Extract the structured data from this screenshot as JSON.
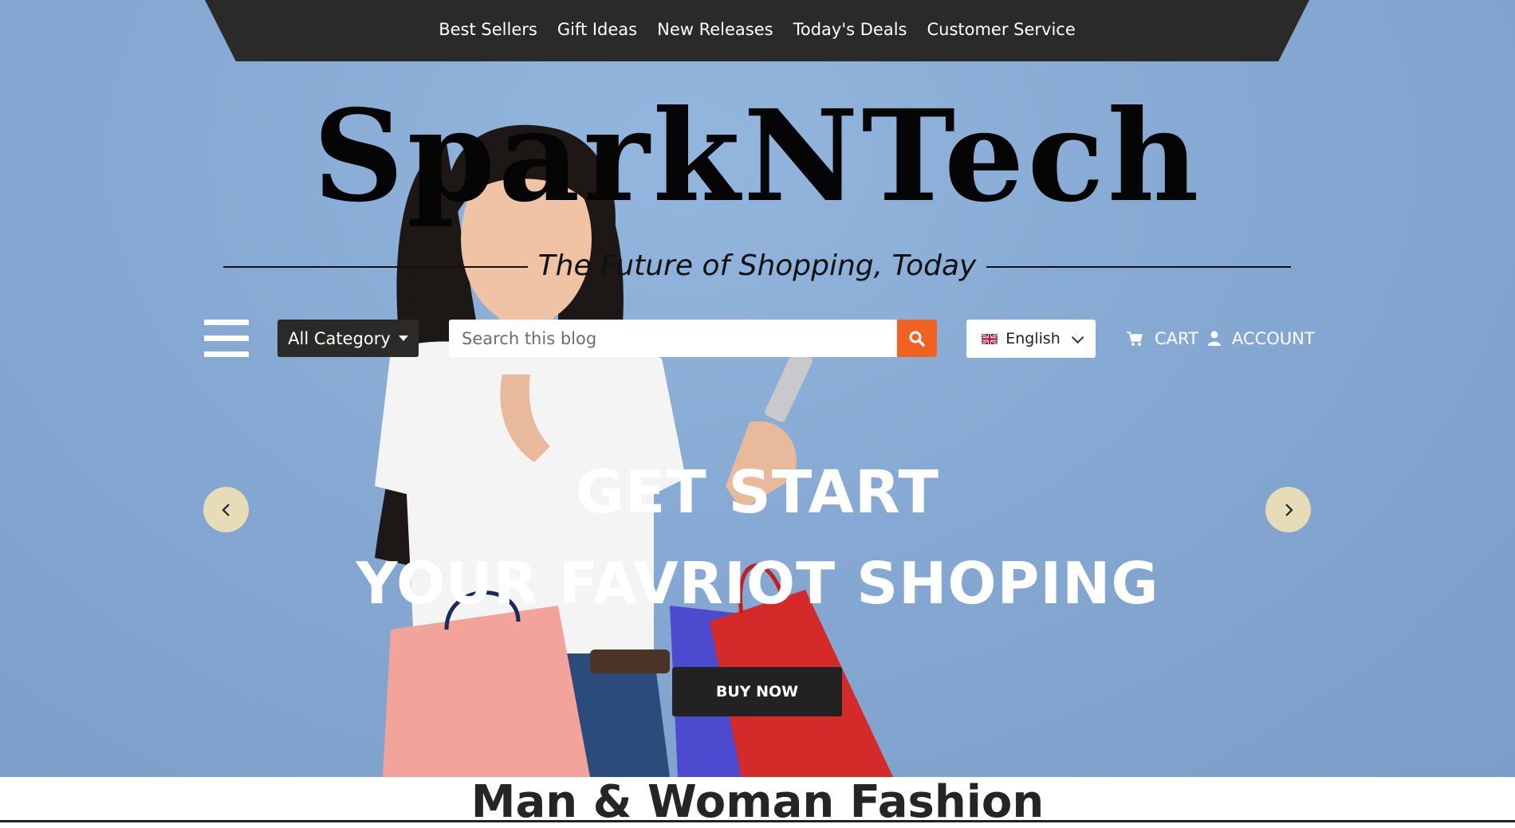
{
  "top_nav": {
    "items": [
      "Best Sellers",
      "Gift Ideas",
      "New Releases",
      "Today's Deals",
      "Customer Service"
    ]
  },
  "brand": {
    "name": "SparkNTech",
    "tagline": "The Future of Shopping, Today"
  },
  "toolbar": {
    "category_label": "All Category",
    "search_placeholder": "Search this blog",
    "language": "English",
    "cart_label": "CART",
    "account_label": "ACCOUNT"
  },
  "hero": {
    "line1": "GET START",
    "line2": "YOUR FAVRIOT SHOPING",
    "cta": "BUY NOW"
  },
  "section": {
    "title": "Man & Woman Fashion"
  },
  "colors": {
    "accent": "#f16222",
    "dark": "#2b2a29",
    "hero_bg": "#86a9d3",
    "arrow_bg": "#e6dcb7"
  }
}
